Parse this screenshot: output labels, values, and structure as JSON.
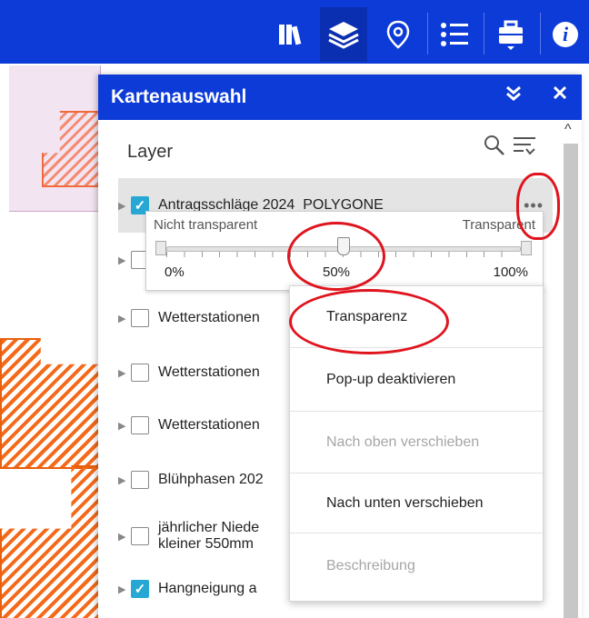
{
  "toolbar": {
    "buttons": [
      {
        "name": "library",
        "icon": "books-icon"
      },
      {
        "name": "layers",
        "icon": "layers-icon",
        "active": true
      },
      {
        "name": "location",
        "icon": "location-pin-icon"
      },
      {
        "name": "legend",
        "icon": "legend-list-icon"
      },
      {
        "name": "toolbox",
        "icon": "toolbox-icon"
      },
      {
        "name": "info",
        "icon": "info-icon",
        "glyph": "i"
      }
    ],
    "color": "#0d3bd8"
  },
  "panel": {
    "title": "Kartenauswahl",
    "collapse_icon": "double-chevron-down-icon",
    "close_icon": "close-icon",
    "layer_heading": "Layer",
    "search_icon": "search-icon",
    "filter_icon": "filter-list-icon"
  },
  "layers": [
    {
      "label": "Antragsschläge 2024_POLYGONE",
      "checked": true
    },
    {
      "label": "",
      "checked": false
    },
    {
      "label": "Wetterstationen",
      "checked": false
    },
    {
      "label": "Wetterstationen",
      "checked": false
    },
    {
      "label": "Wetterstationen",
      "checked": false
    },
    {
      "label": "Blühphasen 202",
      "checked": false
    },
    {
      "label": "jährlicher Niede",
      "label2": "kleiner 550mm",
      "checked": false
    },
    {
      "label": "Hangneigung a",
      "checked": true
    }
  ],
  "layer_menu": {
    "more_icon": "more-options-icon",
    "transparency": {
      "left_label": "Nicht transparent",
      "right_label": "Transparent",
      "tick_0": "0%",
      "tick_50": "50%",
      "tick_100": "100%",
      "value_percent": 50
    },
    "items": [
      {
        "label": "Transparenz",
        "enabled": true
      },
      {
        "label": "Pop-up deaktivieren",
        "enabled": true
      },
      {
        "label": "Nach oben verschieben",
        "enabled": false
      },
      {
        "label": "Nach unten verschieben",
        "enabled": true
      },
      {
        "label": "Beschreibung",
        "enabled": false
      }
    ]
  },
  "annotation_color": "#e0141e"
}
